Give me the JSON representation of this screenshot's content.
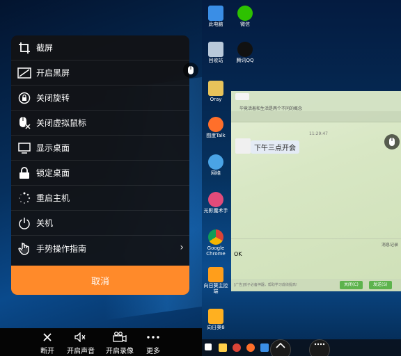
{
  "menu": {
    "items": [
      {
        "label": "截屏",
        "icon": "crop-icon"
      },
      {
        "label": "开启黑屏",
        "icon": "black-screen-icon"
      },
      {
        "label": "关闭旋转",
        "icon": "rotation-lock-icon"
      },
      {
        "label": "关闭虚拟鼠标",
        "icon": "virtual-mouse-off-icon"
      },
      {
        "label": "显示桌面",
        "icon": "monitor-icon"
      },
      {
        "label": "锁定桌面",
        "icon": "lock-icon"
      },
      {
        "label": "重启主机",
        "icon": "restart-icon"
      },
      {
        "label": "关机",
        "icon": "power-icon"
      },
      {
        "label": "手势操作指南",
        "icon": "hand-gesture-icon"
      }
    ],
    "cancel_label": "取消",
    "cancel_color": "#ff8a2a"
  },
  "bottom_bar": {
    "items": [
      {
        "label": "断开",
        "icon": "close-icon"
      },
      {
        "label": "开启声音",
        "icon": "speaker-muted-icon"
      },
      {
        "label": "开启录像",
        "icon": "video-camera-icon"
      },
      {
        "label": "更多",
        "icon": "more-dots-icon"
      }
    ]
  },
  "desktop": {
    "icons": [
      {
        "label": "此电脑",
        "color": "#3a8ee6"
      },
      {
        "label": "微信",
        "color": "#2dc100"
      },
      {
        "label": "回收站",
        "color": "#b9c9da"
      },
      {
        "label": "腾讯QQ",
        "color": "#111111"
      },
      {
        "label": "Oray",
        "color": "#e8c35a"
      },
      {
        "label": "图度Talk",
        "color": "#ff6f2a"
      },
      {
        "label": "网络",
        "color": "#4aa4e6"
      },
      {
        "label": "光影魔术手",
        "color": "#e24b7a"
      },
      {
        "label": "Google Chrome",
        "color": "#db4437"
      },
      {
        "label": "向日葵主控端",
        "color": "#ff9e1b"
      },
      {
        "label": "向日葵8",
        "color": "#ffb020"
      }
    ]
  },
  "chat": {
    "title": "毕竟活着和生活是两个不同的概念",
    "timestamp": "11:29:47",
    "message": "下午三点开会",
    "input_text": "OK",
    "history_label": "消息记录",
    "footer_hint": "[广告]孩子必备神器，帮助学习成绩提高!",
    "close_label": "关闭(C)",
    "send_label": "发送(S)"
  }
}
